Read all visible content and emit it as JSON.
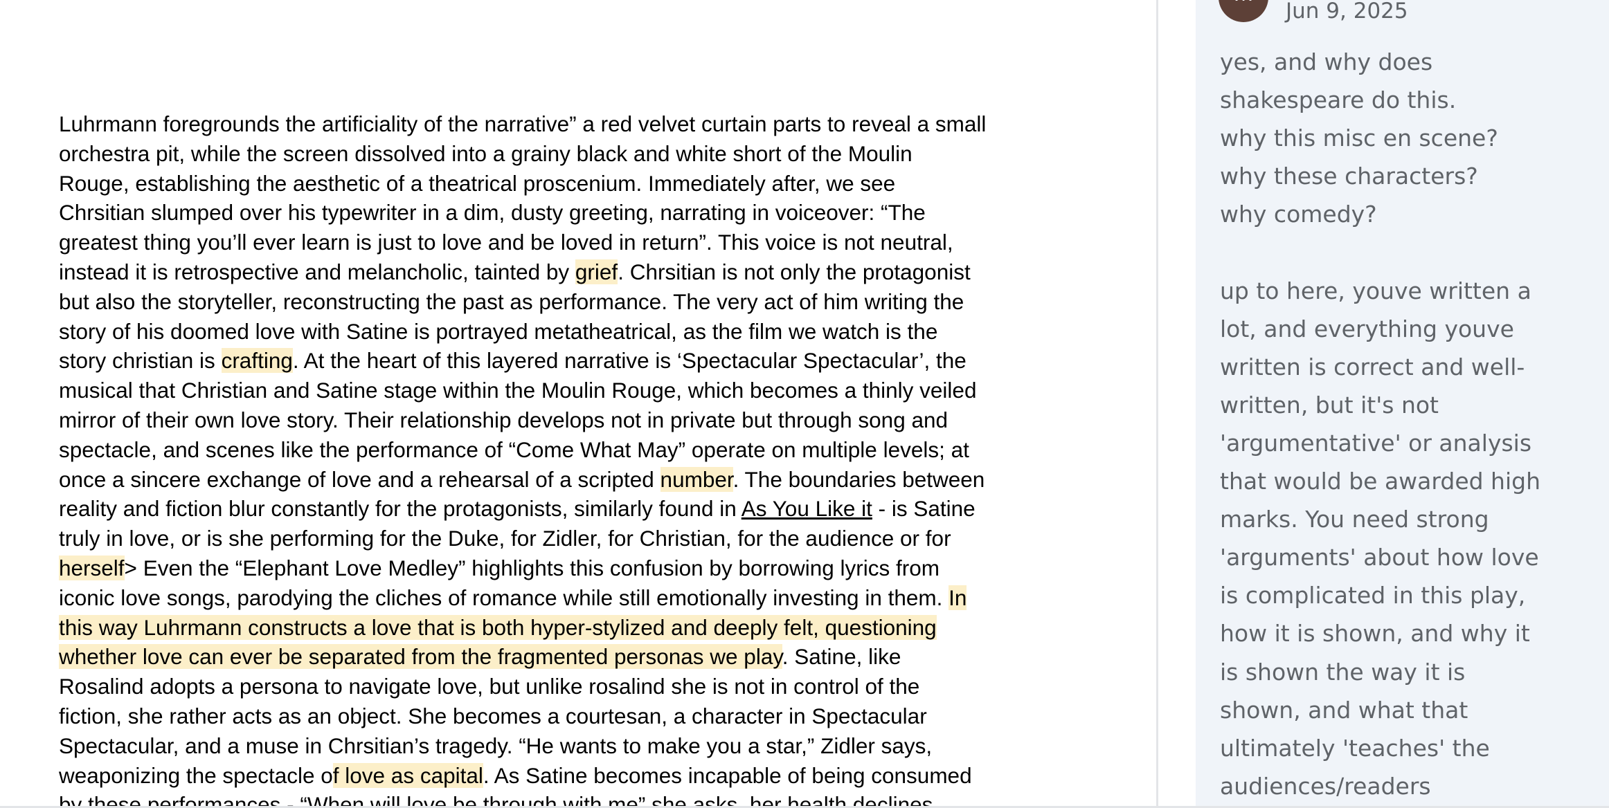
{
  "document": {
    "lines": [
      [
        {
          "t": "Luhrmann foregrounds the artificiality of the narrative” a red velvet curtain parts to reveal a small"
        }
      ],
      [
        {
          "t": "orchestra pit, while the screen dissolved into a grainy black and white short of the Moulin"
        }
      ],
      [
        {
          "t": "Rouge, establishing the aesthetic of a theatrical proscenium. Immediately after, we see"
        }
      ],
      [
        {
          "t": "Chrsitian slumped over his typewriter in a dim, dusty greeting, narrating in voiceover: “The"
        }
      ],
      [
        {
          "t": "greatest thing you’ll ever learn is just to love and be loved in return”. This voice is not neutral,"
        }
      ],
      [
        {
          "t": "instead it is retrospective and melancholic, tainted by "
        },
        {
          "t": "grief",
          "s": "hl"
        },
        {
          "t": ". Chrsitian is not only the protagonist"
        }
      ],
      [
        {
          "t": "but also the storyteller, reconstructing the past as performance. The very act of him writing the"
        }
      ],
      [
        {
          "t": "story of his doomed love with Satine is portrayed metatheatrical, as the film we watch is the"
        }
      ],
      [
        {
          "t": "story christian is "
        },
        {
          "t": "crafting",
          "s": "hl"
        },
        {
          "t": ".  At the heart of this layered narrative is ‘Spectacular Spectacular’, the"
        }
      ],
      [
        {
          "t": "musical that Christian and Satine stage within the Moulin Rouge, which becomes a thinly veiled"
        }
      ],
      [
        {
          "t": "mirror of their own love story. Their relationship develops not in private but through song and"
        }
      ],
      [
        {
          "t": "spectacle, and scenes like the performance of “Come What May” operate on multiple levels; at"
        }
      ],
      [
        {
          "t": "once a sincere exchange of love and a rehearsal of a scripted "
        },
        {
          "t": "number",
          "s": "hl"
        },
        {
          "t": ". The boundaries between"
        }
      ],
      [
        {
          "t": "reality and fiction blur constantly for the protagonists, similarly found in "
        },
        {
          "t": "As You Like it",
          "s": "ul"
        },
        {
          "t": " - is Satine"
        }
      ],
      [
        {
          "t": "truly in love, or is she performing for the Duke, for Zidler, for Christian, for the audience or for"
        }
      ],
      [
        {
          "t": "herself",
          "s": "hl"
        },
        {
          "t": "> Even the “Elephant Love Medley” highlights this confusion by borrowing lyrics from"
        }
      ],
      [
        {
          "t": "iconic love songs, parodying the cliches of romance while still emotionally investing in them. "
        },
        {
          "t": "In",
          "s": "hl"
        }
      ],
      [
        {
          "t": "this way Luhrmann constructs a love that is both hyper-stylized and deeply felt, questioning",
          "s": "hl"
        }
      ],
      [
        {
          "t": "whether love can ever be separated from the fragmented personas we play",
          "s": "hl"
        },
        {
          "t": ". Satine, like"
        }
      ],
      [
        {
          "t": "Rosalind adopts a persona to navigate love, but unlike rosalind she is not in control of the"
        }
      ],
      [
        {
          "t": "fiction, she rather acts as an object. She becomes a courtesan, a character in Spectacular"
        }
      ],
      [
        {
          "t": "Spectacular, and a muse in Chrsitian’s tragedy. “He wants to make you a star,” Zidler says,"
        }
      ],
      [
        {
          "t": "weaponizing the spectacle o"
        },
        {
          "t": "f love as capital",
          "s": "hl"
        },
        {
          "t": ". As Satine becomes incapable of being consumed"
        }
      ],
      [
        {
          "t": "by these performances - “When will love be through with me” she asks, her health declines"
        }
      ]
    ]
  },
  "comment": {
    "avatar_initial": "M",
    "date": "Jun 9, 2025",
    "lines": [
      "yes, and why does",
      "shakespeare do this.",
      "why this misc en scene?",
      "why these characters?",
      "why comedy?",
      "",
      "up to here, youve written a",
      "lot, and everything youve",
      "written is correct and well-",
      "written, but it's not",
      "'argumentative' or analysis",
      "that would be awarded high",
      "marks. You need strong",
      "'arguments' about how love",
      "is complicated in this play,",
      "how it is shown, and why it",
      "is shown the way it is",
      "shown, and what that",
      "ultimately 'teaches' the",
      "audiences/readers"
    ]
  },
  "colors": {
    "highlight": "#fcefc9",
    "comment_background": "#f0f4f9",
    "comment_text": "#5f6368",
    "avatar": "#5d4037"
  }
}
